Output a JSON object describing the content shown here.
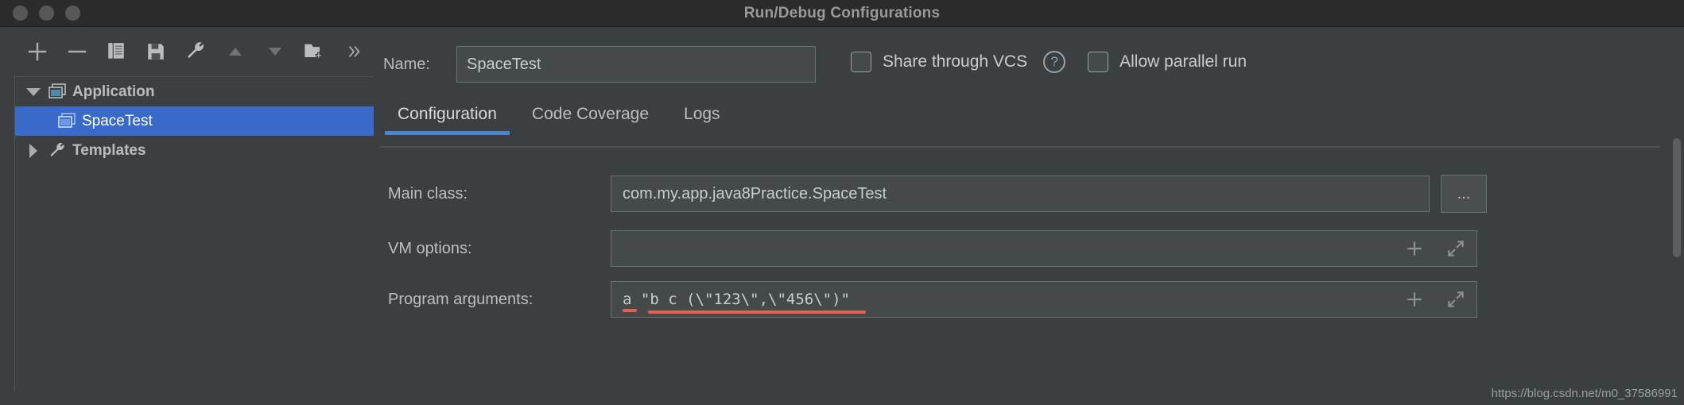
{
  "window": {
    "title": "Run/Debug Configurations",
    "traffic_lights": [
      "close",
      "minimize",
      "zoom"
    ]
  },
  "toolbar": {
    "buttons": [
      {
        "name": "add-icon",
        "label": "+"
      },
      {
        "name": "remove-icon",
        "label": "−"
      },
      {
        "name": "copy-icon",
        "label": "Copy Configuration"
      },
      {
        "name": "save-icon",
        "label": "Save Configuration"
      },
      {
        "name": "edit-templates-icon",
        "label": "Edit Templates"
      },
      {
        "name": "move-up-icon",
        "label": "Move Up"
      },
      {
        "name": "move-down-icon",
        "label": "Move Down"
      },
      {
        "name": "new-folder-icon",
        "label": "Create New Folder"
      },
      {
        "name": "more-icon",
        "label": "»"
      }
    ]
  },
  "tree": {
    "nodes": [
      {
        "label": "Application",
        "icon": "application-icon",
        "expanded": true,
        "selected": false
      },
      {
        "label": "SpaceTest",
        "icon": "application-icon",
        "child": true,
        "selected": true
      },
      {
        "label": "Templates",
        "icon": "wrench-icon",
        "expanded": false,
        "selected": false
      }
    ]
  },
  "name_field": {
    "label": "Name:",
    "value": "SpaceTest",
    "placeholder": ""
  },
  "options": {
    "share_label": "Share through VCS",
    "share_checked": false,
    "help_glyph": "?",
    "parallel_label": "Allow parallel run",
    "parallel_checked": false
  },
  "tabs": [
    {
      "label": "Configuration",
      "active": true
    },
    {
      "label": "Code Coverage",
      "active": false
    },
    {
      "label": "Logs",
      "active": false
    }
  ],
  "form": {
    "main_class": {
      "label": "Main class:",
      "value": "com.my.app.java8Practice.SpaceTest",
      "browse_label": "..."
    },
    "vm_options": {
      "label": "VM options:",
      "value": "",
      "placeholder": ""
    },
    "program_arguments": {
      "label": "Program arguments:",
      "value_prefix": "a",
      "value_rest": " \"b c (\\\"123\\\",\\\"456\\\")\"",
      "value_full": "a \"b c (\\\"123\\\",\\\"456\\\")\"",
      "error_underline_color": "#e8604f"
    },
    "insert_macro_icon": "plus-icon",
    "expand_icon": "expand-icon"
  },
  "colors": {
    "selection_blue": "#3a6ac9",
    "tab_accent": "#4c84d0",
    "error_red": "#e8604f",
    "window_bg": "#3c3f41",
    "titlebar_bg": "#2b2b2b"
  },
  "watermark": {
    "text": "https://blog.csdn.net/m0_37586991"
  }
}
